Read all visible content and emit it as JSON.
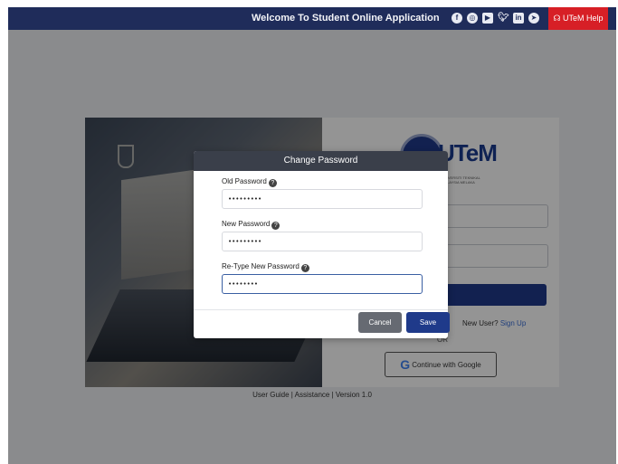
{
  "topbar": {
    "title": "Welcome To Student Online Application",
    "social_icons": [
      "facebook-icon",
      "instagram-icon",
      "youtube-icon",
      "twitter-icon",
      "linkedin-icon",
      "telegram-icon"
    ],
    "help_label": "UTeM Help",
    "background": "#1f2c5a",
    "help_color": "#d71f26"
  },
  "login": {
    "logo_text": "UTeM",
    "logo_subtext": "UNIVERSITI TEKNIKAL MALAYSIA MELAKA",
    "new_user_text": "New User?",
    "sign_up_label": "Sign Up",
    "or_text": "OR",
    "google_label": "Continue with Google"
  },
  "footer": {
    "text": "User Guide | Assistance | Version 1.0"
  },
  "modal": {
    "title": "Change Password",
    "fields": [
      {
        "label": "Old Password",
        "value": "•••••••••"
      },
      {
        "label": "New Password",
        "value": "•••••••••"
      },
      {
        "label": "Re-Type New Password",
        "value": "••••••••"
      }
    ],
    "cancel_label": "Cancel",
    "save_label": "Save"
  }
}
